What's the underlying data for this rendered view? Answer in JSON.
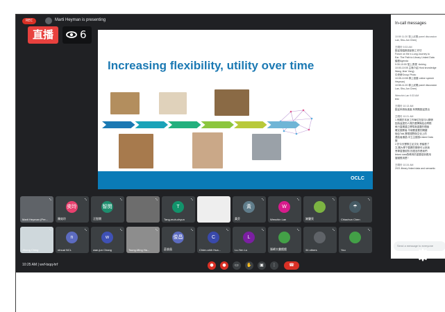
{
  "recording": {
    "label": "REC",
    "presenter_text": "Marti Heyman is presenting"
  },
  "live": {
    "label": "直播",
    "viewer_count": "6",
    "eye_icon": "eye-icon"
  },
  "slide": {
    "title": "Increasing flexibility, utility over time",
    "footer_logo": "OCLC",
    "timeline_colors": [
      "#1b79b3",
      "#1aa3b8",
      "#22b07d",
      "#8cc63e",
      "#b8c93a",
      "#6fb5d6"
    ]
  },
  "chat": {
    "title": "In-call messages",
    "messages": [
      {
        "head": "10:59 11:20 專上武陽 panel discussion",
        "lines": [
          "Lan, Shu-Jun Chen)"
        ]
      },
      {
        "head": "王曉玲  9:33 AM",
        "lines": [
          "歡迎蒞臨數據創新工作坊",
          "Forum on the e-Lung Journey to",
          "Ear: The Path to Library Linked Data",
          "議程Agenda",
          "9:30-10:00 蒞上勇視 ·Ashing",
          "10:00-10:05 主席介紹 Host knowledge",
          "Wang Jiner Yang)",
          "      中央研Group Photo",
          "10:05-10:55 專上葛藤 online speech",
          "Heyman)",
          "10:55-11:20 專上武陽 panel discussion",
          "Lan, Shu-Jun Chen)"
        ]
      },
      {
        "head": "Wenchin Lan  9:33 AM",
        "lines": [
          "test"
        ]
      },
      {
        "head": "王曉玲  10:13 AM",
        "lines": [
          "歡迎申請後進度,有問題歡迎提出"
        ]
      },
      {
        "head": "王曉玲  10:21 AM",
        "lines": [
          "1.有關於本身工作單位在談今1)關係",
          "因為這邊的人員的選擇與結合問題",
          "執行直屬建立標準與重要的理論",
          "確定觀察者,令總要重要的關鍵",
          "個合Talk,實現視野與文化上的",
          "連結者通過,中立主觀感Linked Data",
          "服.",
          "2.於今天實際立足文化,會議發了",
          "文,關大學下觀察的關係可以來我",
          "會學習選前對,的語言的是我們",
          "linked data對教育的重要感到應用",
          "當國應用是?"
        ]
      },
      {
        "head": "王曉玲  10:24 AM",
        "lines": [
          "2021 library linked data and semantic"
        ]
      }
    ],
    "input_placeholder": "Send a message to everyone"
  },
  "tiles": [
    {
      "name": "Marti Heyman (Pre...",
      "initial": "",
      "color": "#5f6368",
      "kind": "photo"
    },
    {
      "name": "陳奕玲",
      "initial": "奕玲",
      "color": "#e8406e",
      "kind": "avatar"
    },
    {
      "name": "汪智閔",
      "initial": "智閔",
      "color": "#1e8e6e",
      "kind": "avatar"
    },
    {
      "name": "",
      "initial": "",
      "color": "#6d6d6d",
      "kind": "photo"
    },
    {
      "name": "Tang-muh-chyun",
      "initial": "T",
      "color": "#12936b",
      "kind": "avatar"
    },
    {
      "name": "",
      "initial": "",
      "color": "#eeeeee",
      "kind": "photo"
    },
    {
      "name": "黃芬",
      "initial": "黃",
      "color": "#607d8b",
      "kind": "avatar"
    },
    {
      "name": "Wenchin Lan",
      "initial": "W",
      "color": "#d81b8c",
      "kind": "avatar"
    },
    {
      "name": "謝肇亮",
      "initial": "",
      "color": "#7cb342",
      "kind": "avatar"
    },
    {
      "name": "Chiachun Chen",
      "initial": "☂",
      "color": "#455a64",
      "kind": "avatar"
    },
    {
      "name": "Jihong Ching",
      "initial": "",
      "color": "#cfd8dc",
      "kind": "photo"
    },
    {
      "name": "ntnuai NCL",
      "initial": "n",
      "color": "#5c6bc0",
      "kind": "avatar"
    },
    {
      "name": "wan-jun Chang",
      "initial": "w",
      "color": "#3f51b5",
      "kind": "avatar"
    },
    {
      "name": "Tsung-Ming Ha...",
      "initial": "",
      "color": "#8d8d8d",
      "kind": "photo"
    },
    {
      "name": "莊俊昌",
      "initial": "俊昌",
      "color": "#5c6bc0",
      "kind": "avatar"
    },
    {
      "name": "Chien-shih Hua...",
      "initial": "C",
      "color": "#3949ab",
      "kind": "avatar"
    },
    {
      "name": "Lu-Yen Lu",
      "initial": "L",
      "color": "#7b1fa2",
      "kind": "avatar"
    },
    {
      "name": "張師大書館館",
      "initial": "",
      "color": "#43a047",
      "kind": "avatar"
    },
    {
      "name": "34 others",
      "initial": "",
      "color": "#5f6368",
      "kind": "others"
    },
    {
      "name": "You",
      "initial": "",
      "color": "#43a047",
      "kind": "avatar"
    }
  ],
  "bottom": {
    "time": "10:25 AM",
    "separator": "|",
    "meeting_code": "wvf-tsqq-hrf"
  }
}
